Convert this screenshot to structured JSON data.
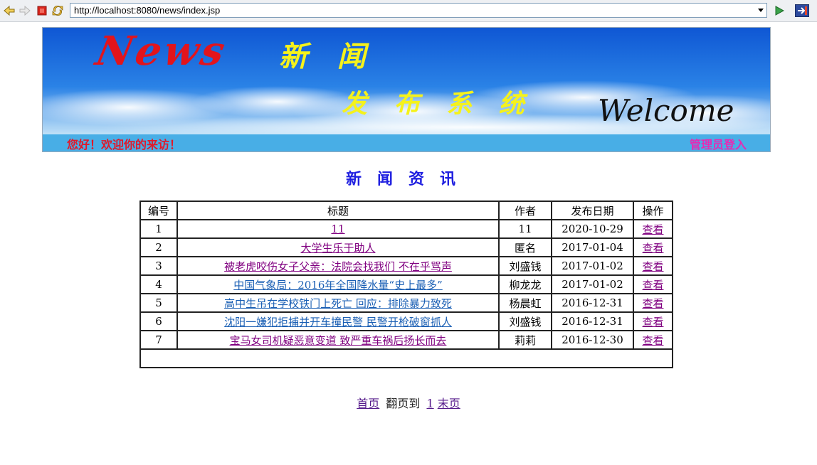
{
  "browser": {
    "url": "http://localhost:8080/news/index.jsp"
  },
  "banner": {
    "logo_text": "News",
    "title_line1": "新   闻",
    "title_line2": "发   布   系   统",
    "welcome_script": "Welcome",
    "greeting": "您好！欢迎你的来访！",
    "admin_login": "管理员登入"
  },
  "page_title": "新闻资讯",
  "table": {
    "headers": [
      "编号",
      "标题",
      "作者",
      "发布日期",
      "操作"
    ],
    "rows": [
      {
        "id": "1",
        "title": "11",
        "author": "11",
        "date": "2020-10-29",
        "action": "查看",
        "visited": true
      },
      {
        "id": "2",
        "title": "大学生乐于助人",
        "author": "匿名",
        "date": "2017-01-04",
        "action": "查看",
        "visited": true
      },
      {
        "id": "3",
        "title": "被老虎咬伤女子父亲：法院会找我们 不在乎骂声",
        "author": "刘盛钱",
        "date": "2017-01-02",
        "action": "查看",
        "visited": true
      },
      {
        "id": "4",
        "title": "中国气象局：2016年全国降水量“史上最多”",
        "author": "柳龙龙",
        "date": "2017-01-02",
        "action": "查看",
        "visited": false
      },
      {
        "id": "5",
        "title": "高中生吊在学校铁门上死亡 回应：排除暴力致死",
        "author": "杨晨虹",
        "date": "2016-12-31",
        "action": "查看",
        "visited": false
      },
      {
        "id": "6",
        "title": "沈阳一嫌犯拒捕并开车撞民警 民警开枪破窗抓人",
        "author": "刘盛钱",
        "date": "2016-12-31",
        "action": "查看",
        "visited": false
      },
      {
        "id": "7",
        "title": "宝马女司机疑恶意变道 致严重车祸后扬长而去",
        "author": "莉莉",
        "date": "2016-12-30",
        "action": "查看",
        "visited": true
      }
    ]
  },
  "pager": {
    "first": "首页",
    "goto": "翻页到",
    "page": "1",
    "last": "末页"
  },
  "colors": {
    "banner_bar": "#48aee6",
    "greeting": "#e0192a",
    "admin": "#e62bb4",
    "title": "#2020e0",
    "visited_link": "#800080",
    "link": "#1a5fb4"
  }
}
